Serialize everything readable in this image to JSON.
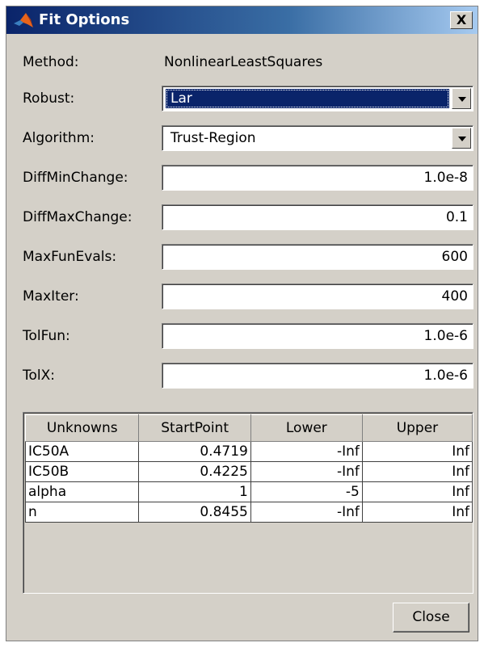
{
  "window": {
    "title": "Fit Options",
    "close_glyph": "X",
    "icon": "matlab-logo-icon"
  },
  "form": {
    "method_label": "Method:",
    "method_value": "NonlinearLeastSquares",
    "robust_label": "Robust:",
    "robust_value": "Lar",
    "algorithm_label": "Algorithm:",
    "algorithm_value": "Trust-Region",
    "diffminchange_label": "DiffMinChange:",
    "diffminchange_value": "1.0e-8",
    "diffmaxchange_label": "DiffMaxChange:",
    "diffmaxchange_value": "0.1",
    "maxfunevals_label": "MaxFunEvals:",
    "maxfunevals_value": "600",
    "maxiter_label": "MaxIter:",
    "maxiter_value": "400",
    "tolfun_label": "TolFun:",
    "tolfun_value": "1.0e-6",
    "tolx_label": "TolX:",
    "tolx_value": "1.0e-6"
  },
  "table": {
    "headers": [
      "Unknowns",
      "StartPoint",
      "Lower",
      "Upper"
    ],
    "rows": [
      [
        "IC50A",
        "0.4719",
        "-Inf",
        "Inf"
      ],
      [
        "IC50B",
        "0.4225",
        "-Inf",
        "Inf"
      ],
      [
        "alpha",
        "1",
        "-5",
        "Inf"
      ],
      [
        "n",
        "0.8455",
        "-Inf",
        "Inf"
      ]
    ]
  },
  "buttons": {
    "close_label": "Close"
  },
  "colors": {
    "titlebar_start": "#0a246a",
    "titlebar_end": "#a6caf0",
    "dialog_bg": "#d4d0c8",
    "selection": "#0a246a"
  }
}
